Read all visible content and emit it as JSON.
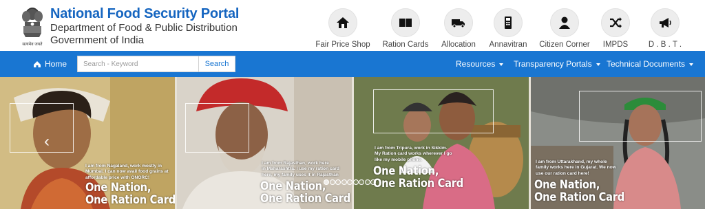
{
  "header": {
    "title": "National Food Security Portal",
    "department": "Department of Food & Public Distribution",
    "government": "Government of India",
    "emblem_motto": "सत्यमेव जयते"
  },
  "quick_links": [
    {
      "label": "Fair Price Shop",
      "icon": "shop-icon"
    },
    {
      "label": "Ration Cards",
      "icon": "book-icon"
    },
    {
      "label": "Allocation",
      "icon": "truck-icon"
    },
    {
      "label": "Annavitran",
      "icon": "pos-device-icon"
    },
    {
      "label": "Citizen Corner",
      "icon": "user-icon"
    },
    {
      "label": "IMPDS",
      "icon": "shuffle-icon"
    },
    {
      "label": "D . B . T .",
      "icon": "megaphone-icon"
    }
  ],
  "nav": {
    "home_label": "Home",
    "search_placeholder": "Search - Keyword",
    "search_button": "Search",
    "menus": [
      "Resources",
      "Transparency Portals",
      "Technical Documents"
    ]
  },
  "slides": [
    {
      "quote": [
        "I am from Nagaland, work mostly in",
        "Mumbai. I can now avail food grains at",
        "affordable price with ONORC!"
      ],
      "slogan": [
        "One Nation,",
        "One Ration Card"
      ]
    },
    {
      "quote": [
        "I am from Rajasthan, work here",
        "in Maharashtra. I use my ration card",
        "here, my family uses it in Rajasthan"
      ],
      "slogan": [
        "One Nation,",
        "One Ration Card"
      ]
    },
    {
      "quote": [
        "I am from Tripura, work in Sikkim.",
        "My Ration card works wherever I go",
        "like my mobile phone."
      ],
      "slogan": [
        "One Nation,",
        "One Ration Card"
      ]
    },
    {
      "quote": [
        "I am from Uttarakhand, my whole",
        "family works here in Gujarat. We now",
        "use our ration card here!"
      ],
      "slogan": [
        "One Nation,",
        "One Ration Card"
      ]
    }
  ],
  "slider": {
    "prev_arrow": "‹",
    "dot_count": 9,
    "active_dot": 0
  },
  "colors": {
    "brand_blue": "#1565c0",
    "nav_blue": "#1976d2"
  }
}
